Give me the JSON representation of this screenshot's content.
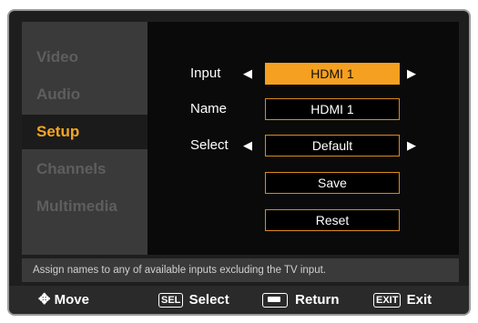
{
  "menu": {
    "items": [
      {
        "label": "Video"
      },
      {
        "label": "Audio"
      },
      {
        "label": "Setup"
      },
      {
        "label": "Channels"
      },
      {
        "label": "Multimedia"
      }
    ],
    "selected": "Setup"
  },
  "settings": {
    "input_label": "Input",
    "input_value": "HDMI 1",
    "name_label": "Name",
    "name_value": "HDMI 1",
    "select_label": "Select",
    "select_value": "Default",
    "save_label": "Save",
    "reset_label": "Reset"
  },
  "help_text": "Assign names to any of available inputs excluding the TV input.",
  "footer": {
    "move_label": "Move",
    "sel_key": "SEL",
    "select_label": "Select",
    "return_label": "Return",
    "exit_key": "EXIT",
    "exit_label": "Exit"
  },
  "colors": {
    "accent": "#f5a623",
    "field_border": "#d98a1c",
    "selected_field": "#f5a020"
  },
  "icons": {
    "left_arrow": "left-triangle",
    "right_arrow": "right-triangle",
    "move": "four-way-arrow",
    "return": "return-key"
  }
}
